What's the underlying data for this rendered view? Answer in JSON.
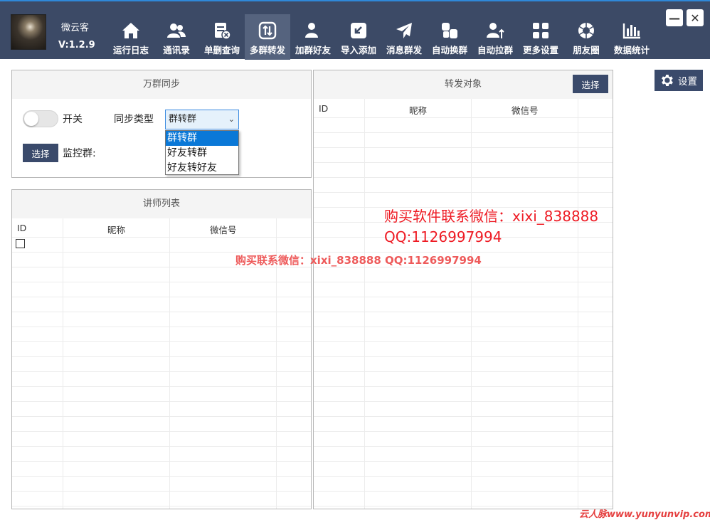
{
  "app": {
    "name": "微云客",
    "version": "V:1.2.9"
  },
  "nav": [
    {
      "label": "运行日志",
      "icon": "home-icon",
      "active": false
    },
    {
      "label": "通讯录",
      "icon": "contacts-icon",
      "active": false
    },
    {
      "label": "单删查询",
      "icon": "delete-check-icon",
      "active": false
    },
    {
      "label": "多群转发",
      "icon": "swap-icon",
      "active": true
    },
    {
      "label": "加群好友",
      "icon": "add-friend-icon",
      "active": false
    },
    {
      "label": "导入添加",
      "icon": "import-icon",
      "active": false
    },
    {
      "label": "消息群发",
      "icon": "send-icon",
      "active": false
    },
    {
      "label": "自动换群",
      "icon": "switch-group-icon",
      "active": false
    },
    {
      "label": "自动拉群",
      "icon": "pull-group-icon",
      "active": false
    },
    {
      "label": "更多设置",
      "icon": "grid-icon",
      "active": false
    },
    {
      "label": "朋友圈",
      "icon": "aperture-icon",
      "active": false
    },
    {
      "label": "数据统计",
      "icon": "bar-chart-icon",
      "active": false
    }
  ],
  "window": {
    "minimize": "—",
    "close": "✕"
  },
  "sync_panel": {
    "title": "万群同步",
    "switch_label": "开关",
    "sync_type_label": "同步类型",
    "sync_type_value": "群转群",
    "options": [
      "群转群",
      "好友转群",
      "好友转好友"
    ],
    "select_button": "选择",
    "monitor_label": "监控群:"
  },
  "teacher_panel": {
    "title": "讲师列表",
    "columns": [
      "ID",
      "昵称",
      "微信号"
    ]
  },
  "forward_panel": {
    "title": "转发对象",
    "select_button": "选择",
    "columns": [
      "ID",
      "昵称",
      "微信号"
    ]
  },
  "settings_button": "设置",
  "watermark": {
    "line1": "购买软件联系微信：xixi_838888",
    "line2": "QQ:1126997994",
    "line3": "购买联系微信：xixi_838888    QQ:1126997994",
    "footer": "云人脉www.yunyunvip.com"
  },
  "colors": {
    "topbar": "#3c4a66",
    "accent": "#3a4a6b",
    "watermark": "#ee1b24",
    "selected": "#0a78d7"
  }
}
